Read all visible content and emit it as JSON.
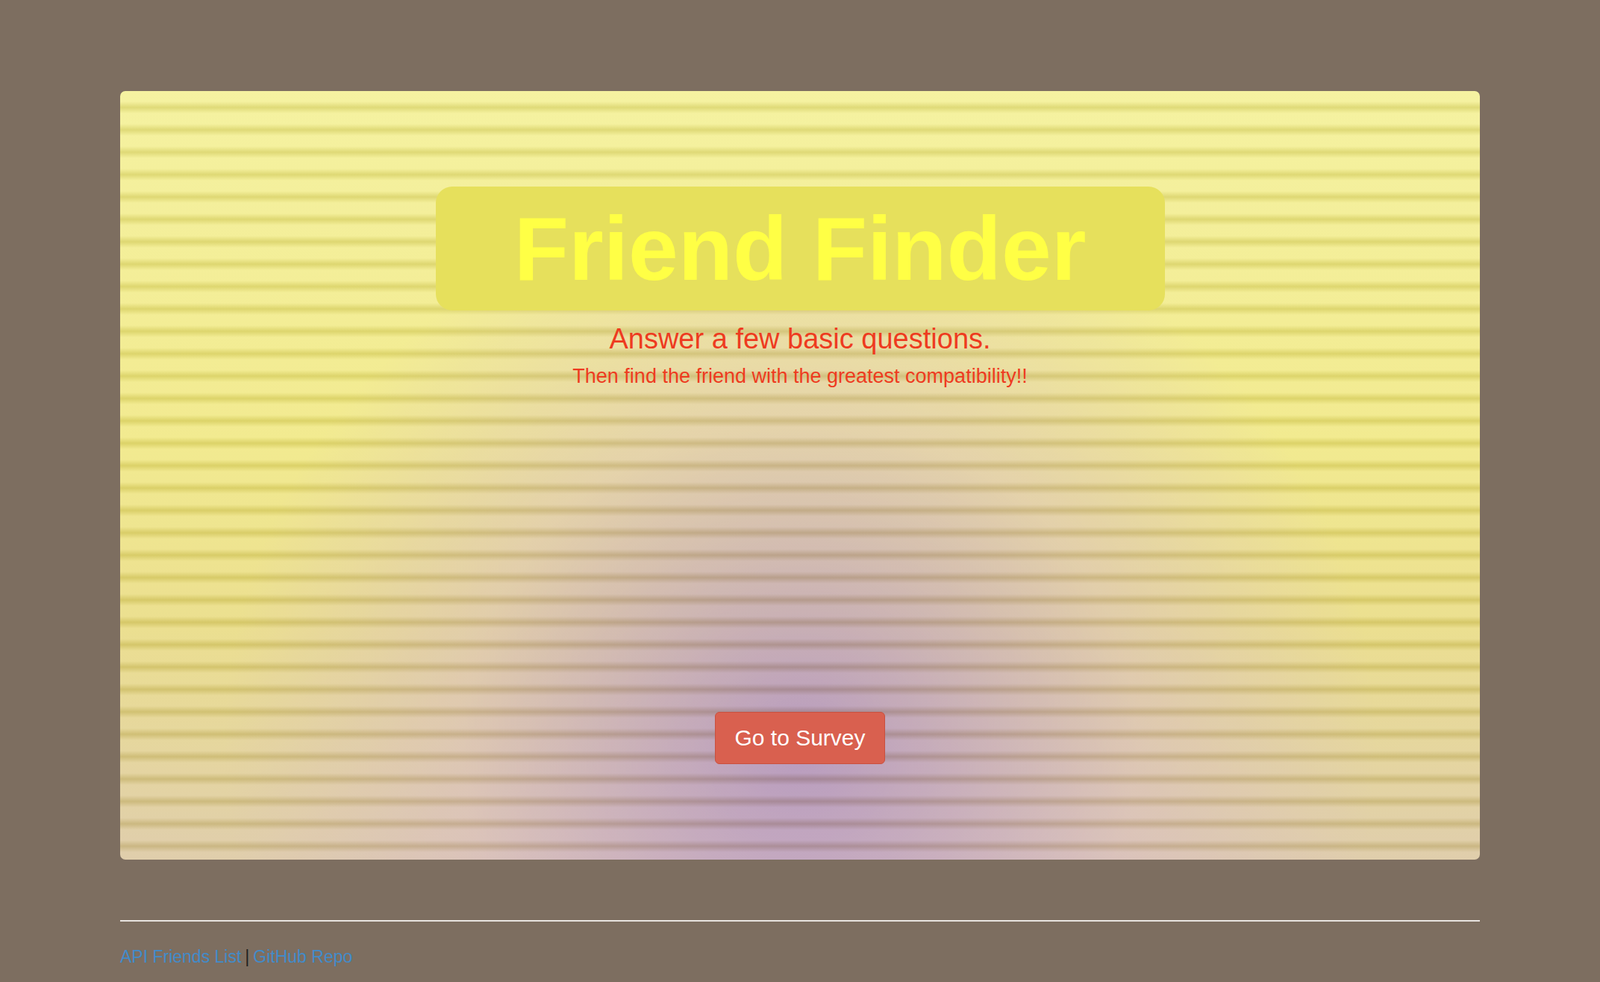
{
  "hero": {
    "title": "Friend Finder",
    "subtitle": "Answer a few basic questions.",
    "tagline": "Then find the friend with the greatest compatibility!!",
    "button": "Go to Survey"
  },
  "footer": {
    "links": [
      {
        "label": "API Friends List"
      },
      {
        "label": "GitHub Repo"
      }
    ],
    "separator": "|"
  }
}
